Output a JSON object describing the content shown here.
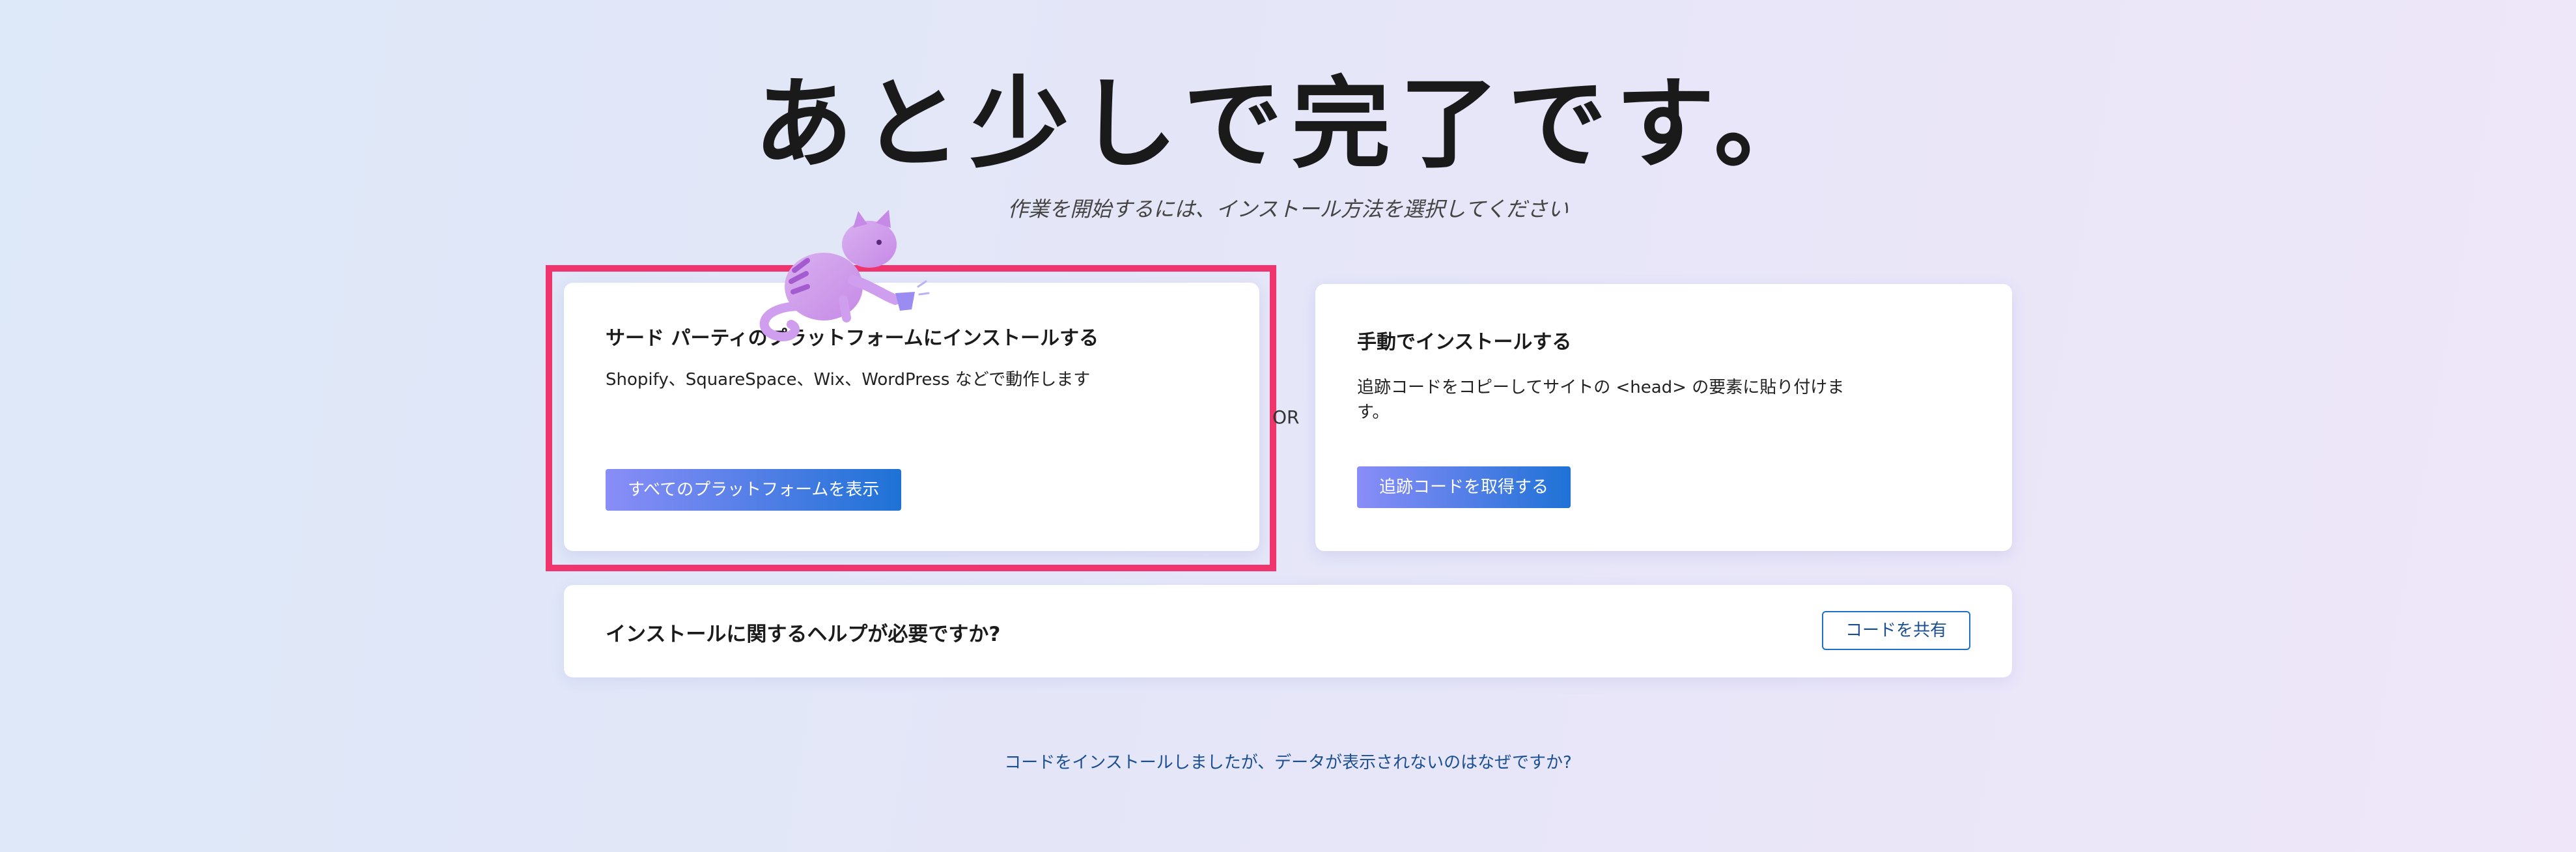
{
  "hero": {
    "title": "あと少しで完了です。",
    "subtitle": "作業を開始するには、インストール方法を選択してください"
  },
  "third_party_card": {
    "title": "サード パーティのプラットフォームにインストールする",
    "description": "Shopify、SquareSpace、Wix、WordPress などで動作します",
    "button_label": "すべてのプラットフォームを表示",
    "highlighted": true
  },
  "separator": {
    "label": "OR"
  },
  "manual_card": {
    "title": "手動でインストールする",
    "description": "追跡コードをコピーしてサイトの <head> の要素に貼り付けます。",
    "button_label": "追跡コードを取得する"
  },
  "help_bar": {
    "title": "インストールに関するヘルプが必要ですか?",
    "button_label": "コードを共有"
  },
  "footer": {
    "link_text": "コードをインストールしましたが、データが表示されないのはなぜですか?"
  },
  "illustration": {
    "icon": "cat-illustration"
  },
  "colors": {
    "highlight_border": "#f0346e",
    "primary_button_start": "#8a8df8",
    "primary_button_end": "#1e72d6",
    "link": "#1b4f91"
  }
}
